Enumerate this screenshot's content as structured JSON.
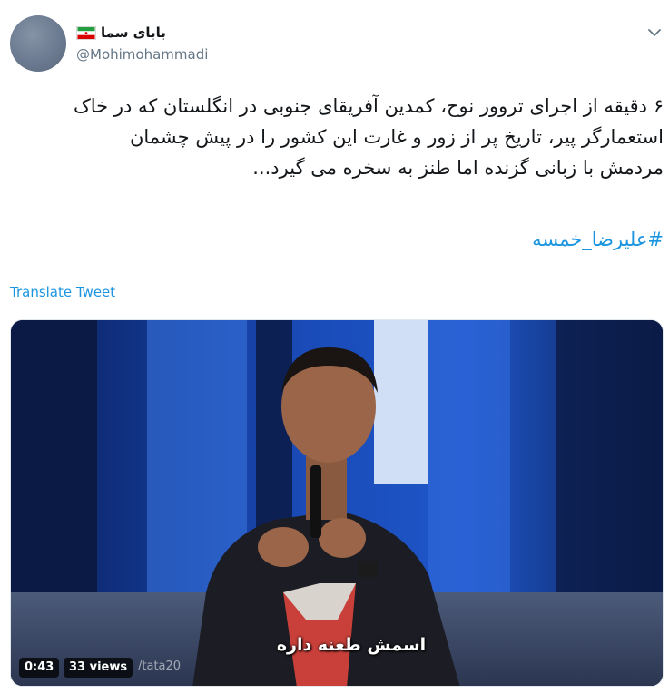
{
  "author": {
    "display_name": "بابای سما",
    "handle": "@Mohimohammadi"
  },
  "tweet": {
    "text_lines": [
      "۶ دقیقه از اجرای تروور نوح، کمدین آفریقای جنوبی در انگلستان که در خاک",
      "استعمارگر پیر، تاریخ پر از زور و غارت این کشور را در پیش چشمان",
      "مردمش با زبانی گزنده اما طنز به سخره می گیرد..."
    ],
    "hashtag": "#علیرضا_خمسه",
    "translate_label": "Translate Tweet"
  },
  "video": {
    "duration": "0:43",
    "views": "33 views",
    "subtitle": "اسمش طعنه داره",
    "watermark": "/tata20"
  },
  "colors": {
    "link": "#1b95e0",
    "secondary_text": "#657786",
    "primary_text": "#14171a"
  }
}
